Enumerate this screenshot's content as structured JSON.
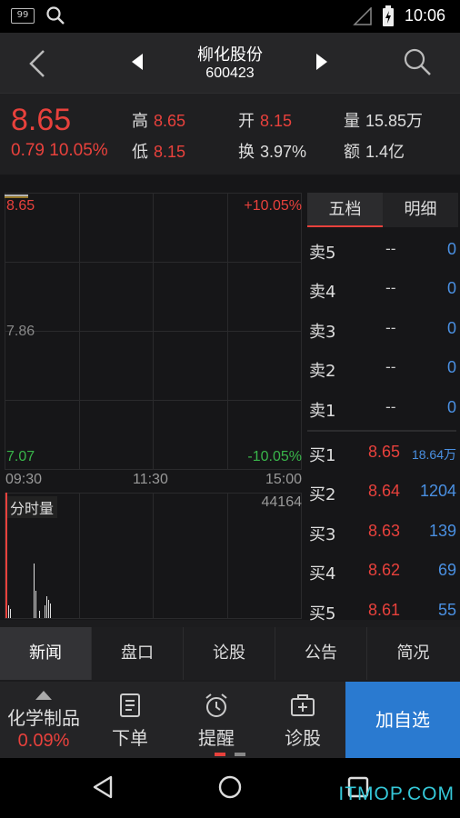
{
  "status_bar": {
    "badge": "99",
    "time": "10:06"
  },
  "header": {
    "stock_name": "柳化股份",
    "stock_code": "600423"
  },
  "quote": {
    "price": "8.65",
    "change": "0.79 10.05%",
    "high_label": "高",
    "high": "8.65",
    "low_label": "低",
    "low": "8.15",
    "open_label": "开",
    "open": "8.15",
    "turnover_label": "换",
    "turnover": "3.97%",
    "volume_label": "量",
    "volume": "15.85万",
    "amount_label": "额",
    "amount": "1.4亿"
  },
  "chart": {
    "top_price": "8.65",
    "mid_price": "7.86",
    "bottom_price": "7.07",
    "top_pct": "+10.05%",
    "bottom_pct": "-10.05%",
    "time_start": "09:30",
    "time_mid": "11:30",
    "time_end": "15:00",
    "volume_title": "分时量",
    "volume_max": "44164"
  },
  "chart_data": {
    "type": "line",
    "title": "",
    "xlabel": "",
    "ylabel": "",
    "ylim": [
      7.07,
      8.65
    ],
    "x_ticks": [
      "09:30",
      "11:30",
      "15:00"
    ],
    "series": [
      {
        "values": [
          8.65,
          8.65
        ]
      }
    ],
    "volume_max": 44164
  },
  "order_book": {
    "tabs": [
      "五档",
      "明细"
    ],
    "sell": [
      {
        "label": "卖5",
        "price": "--",
        "vol": "0"
      },
      {
        "label": "卖4",
        "price": "--",
        "vol": "0"
      },
      {
        "label": "卖3",
        "price": "--",
        "vol": "0"
      },
      {
        "label": "卖2",
        "price": "--",
        "vol": "0"
      },
      {
        "label": "卖1",
        "price": "--",
        "vol": "0"
      }
    ],
    "buy": [
      {
        "label": "买1",
        "price": "8.65",
        "vol": "18.64万"
      },
      {
        "label": "买2",
        "price": "8.64",
        "vol": "1204"
      },
      {
        "label": "买3",
        "price": "8.63",
        "vol": "139"
      },
      {
        "label": "买4",
        "price": "8.62",
        "vol": "69"
      },
      {
        "label": "买5",
        "price": "8.61",
        "vol": "55"
      }
    ]
  },
  "news_tabs": [
    "新闻",
    "盘口",
    "论股",
    "公告",
    "简况"
  ],
  "actions": {
    "sector_name": "化学制品",
    "sector_change": "0.09%",
    "order": "下单",
    "remind": "提醒",
    "diagnose": "诊股",
    "add_watch": "加自选"
  },
  "watermark": "ITMOP.COM",
  "colors": {
    "up": "#e8413c",
    "down": "#39b54a",
    "accent": "#2a7ad0",
    "volume": "#4a90e2"
  }
}
